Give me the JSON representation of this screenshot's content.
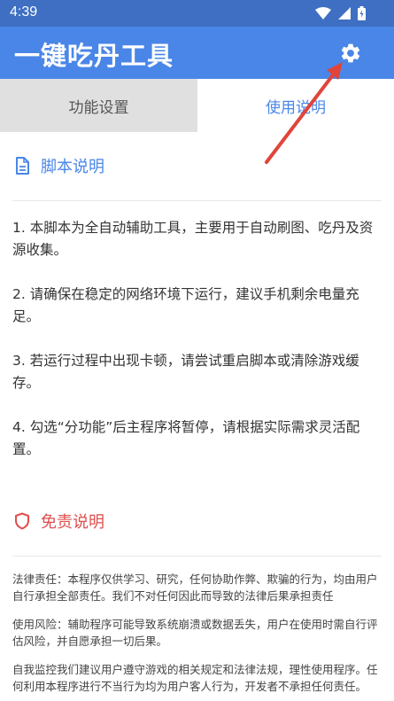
{
  "status_bar": {
    "time": "4:39"
  },
  "app_bar": {
    "title": "一键吃丹工具"
  },
  "tabs": [
    {
      "label": "功能设置",
      "active": false
    },
    {
      "label": "使用说明",
      "active": true
    }
  ],
  "script_section": {
    "title": "脚本说明",
    "items": [
      "1. 本脚本为全自动辅助工具，主要用于自动刷图、吃丹及资源收集。",
      "2. 请确保在稳定的网络环境下运行，建议手机剩余电量充足。",
      "3. 若运行过程中出现卡顿，请尝试重启脚本或清除游戏缓存。",
      "4. 勾选“分功能”后主程序将暂停，请根据实际需求灵活配置。"
    ]
  },
  "disclaimer_section": {
    "title": "免责说明",
    "items": [
      "法律责任：本程序仅供学习、研究，任何协助作弊、欺骗的行为，均由用户自行承担全部责任。我们不对任何因此而导致的法律后果承担责任",
      "使用风险：辅助程序可能导致系统崩溃或数据丢失，用户在使用时需自行评估风险，并自愿承担一切后果。",
      "自我监控我们建议用户遵守游戏的相关规定和法律法规，理性使用程序。任何利用本程序进行不当行为均为用户客人行为，开发者不承担任何责任。"
    ]
  },
  "colors": {
    "status_bar": "#3e6fc2",
    "app_bar": "#4a86e8",
    "accent": "#4a86e8",
    "warning": "#e04f4f",
    "annotation_arrow": "#e0443a"
  },
  "icons": {
    "settings": "gear-icon",
    "script_section": "document-icon",
    "disclaimer_section": "shield-icon",
    "status": [
      "wifi-icon",
      "signal-icon",
      "battery-icon"
    ]
  }
}
